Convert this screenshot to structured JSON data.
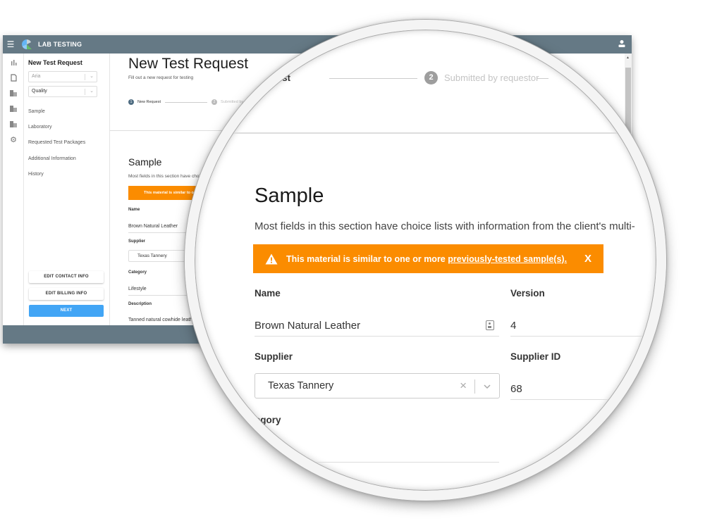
{
  "app": {
    "title": "LAB TESTING",
    "menu_icon": "hamburger-menu-icon",
    "user_icon": "user-icon"
  },
  "rail": {
    "items": [
      {
        "icon": "chart-icon",
        "glyph": "‖"
      },
      {
        "icon": "document-icon",
        "glyph": "▯"
      },
      {
        "icon": "folder-icon",
        "glyph": "■"
      },
      {
        "icon": "folder-icon",
        "glyph": "■"
      },
      {
        "icon": "folder-icon",
        "glyph": "■"
      },
      {
        "icon": "gear-icon",
        "glyph": "⚙"
      }
    ]
  },
  "sidebar": {
    "title": "New Test Request",
    "select_1": {
      "value": "Aria"
    },
    "select_2": {
      "value": "Quality"
    },
    "nav": [
      {
        "label": "Sample"
      },
      {
        "label": "Laboratory"
      },
      {
        "label": "Requested Test Packages"
      },
      {
        "label": "Additional Information"
      },
      {
        "label": "History"
      }
    ],
    "buttons": {
      "edit_contact": "EDIT CONTACT INFO",
      "edit_billing": "EDIT BILLING INFO",
      "next": "NEXT"
    }
  },
  "main": {
    "title": "New Test Request",
    "subtitle": "Fill out a new request for testing",
    "stepper": [
      {
        "num": "1",
        "label": "New Request",
        "active": true
      },
      {
        "num": "2",
        "label": "Submitted by requestor",
        "active": false
      }
    ],
    "section": {
      "title": "Sample",
      "subtitle": "Most fields in this section have choice lists with information from the client's multi-",
      "subtitle_short": "Most fields in this section have choic",
      "alert": {
        "text": "This material is similar to one or more ",
        "link": "previously-tested sample(s).",
        "close": "X",
        "short": "This material is similar to one or"
      },
      "fields": {
        "name": {
          "label": "Name",
          "value": "Brown Natural Leather"
        },
        "version": {
          "label": "Version",
          "value": "4"
        },
        "supplier": {
          "label": "Supplier",
          "value": "Texas Tannery"
        },
        "supplier_id": {
          "label": "Supplier ID",
          "value": "68"
        },
        "category": {
          "label": "Category",
          "label_partial": "nory",
          "value": "Lifestyle"
        },
        "description": {
          "label": "Description",
          "value": "Tanned natural cowhide leather fo"
        }
      }
    }
  },
  "colors": {
    "topbar": "#657985",
    "alert": "#fb8c00",
    "primary_button": "#42a5f5",
    "step_active": "#4f6d82"
  }
}
